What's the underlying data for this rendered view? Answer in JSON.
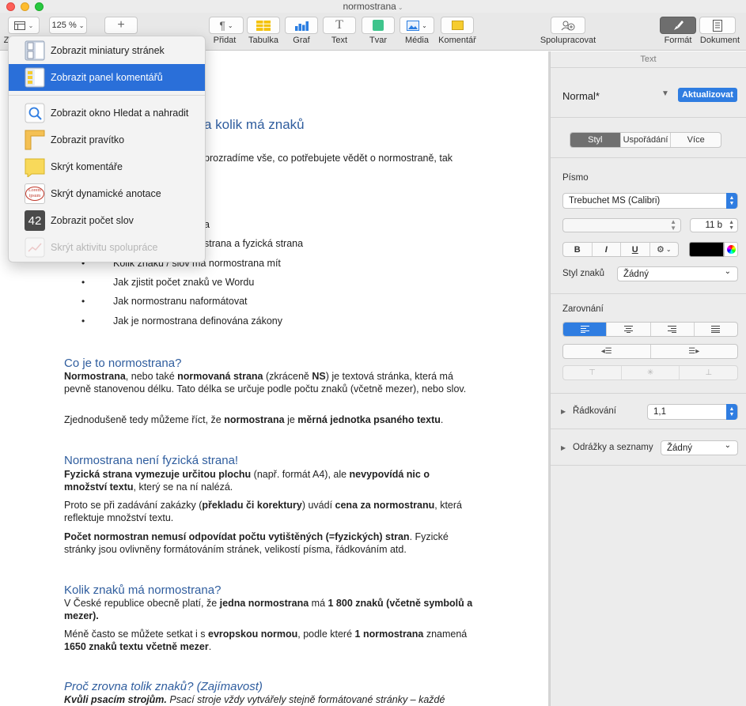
{
  "window": {
    "title": "normostrana"
  },
  "toolbar": {
    "view_label": "Z",
    "zoom_value": "125 %",
    "add_page_symbol": "+",
    "insert_label": "Přidat",
    "table_label": "Tabulka",
    "chart_label": "Graf",
    "text_label": "Text",
    "shape_label": "Tvar",
    "media_label": "Média",
    "comment_label": "Komentář",
    "collaborate_label": "Spolupracovat",
    "format_label": "Formát",
    "document_label": "Dokument"
  },
  "view_menu": {
    "items": [
      {
        "label": "Zobrazit miniatury stránek",
        "icon": "page-thumbnails-icon"
      },
      {
        "label": "Zobrazit panel komentářů",
        "icon": "comments-pane-icon"
      },
      {
        "label": "Zobrazit okno Hledat a nahradit",
        "icon": "magnifier-icon"
      },
      {
        "label": "Zobrazit pravítko",
        "icon": "ruler-icon"
      },
      {
        "label": "Skrýt komentáře",
        "icon": "sticky-note-icon"
      },
      {
        "label": "Skrýt dynamické anotace",
        "icon": "lorem-ipsum-icon",
        "icon_text": "Lorem ipsum"
      },
      {
        "label": "Zobrazit počet slov",
        "icon": "word-count-icon",
        "icon_text": "42"
      },
      {
        "label": "Skrýt aktivitu spolupráce",
        "icon": "collaboration-activity-icon"
      }
    ]
  },
  "document": {
    "title_fragment": "a kolik má znaků",
    "intro_fragment": "prozradíme vše, co potřebujete vědět o normostraně, tak",
    "toc": [
      "a",
      "strana a fyzická strana",
      "Kolik znaků / slov má normostrana mít",
      "Jak zjistit počet znaků ve Wordu",
      "Jak normostranu naformátovat",
      "Jak je normostrana definována zákony"
    ],
    "bullet_char": "•",
    "h_what": "Co je to normostrana?",
    "p_what_1": "<b>Normostrana</b>, nebo také <b>normovaná strana</b> (zkráceně <b>NS</b>) je textová stránka, která má pevně stanovenou délku. Tato délka se určuje podle počtu znaků (včetně mezer), nebo slov.",
    "p_what_2": "Zjednodušeně tedy můžeme říct, že <b>normostrana</b> je <b>měrná jednotka psaného textu</b>.",
    "h_phys": "Normostrana není fyzická strana!",
    "p_phys_1": "<b>Fyzická strana vymezuje určitou plochu</b> (např. formát A4), ale <b>nevypovídá nic o množství textu</b>, který se na ní nalézá.",
    "p_phys_2": "Proto se při zadávání zakázky (<b>překladu či korektury</b>) uvádí <b>cena za normostranu</b>, která reflektuje množství textu.",
    "p_phys_3": "<b>Počet normostran nemusí odpovídat počtu vytištěných (=fyzických) stran</b>. Fyzické stránky jsou ovlivněny formátováním stránek, velikostí písma, řádkováním atd.",
    "h_count": "Kolik znaků má normostrana?",
    "p_count_1": "V České republice obecně platí, že <b>jedna normostrana</b> má <b>1 800 znaků (včetně symbolů a mezer).</b>",
    "p_count_2": "Méně často se můžete setkat i s <b>evropskou normou</b>, podle které <b>1 normostrana</b> znamená <b>1650 znaků textu včetně mezer</b>.",
    "h_why": "Proč zrovna tolik znaků? (Zajímavost)",
    "p_why": "<b>Kvůli psacím strojům.</b> Psací stroje vždy vytvářely stejně formátované stránky – každé"
  },
  "format_panel": {
    "tab_title": "Text",
    "style_name": "Normal*",
    "update_button": "Aktualizovat",
    "tabs": [
      "Styl",
      "Uspořádání",
      "Více"
    ],
    "font_section": "Písmo",
    "font_name": "Trebuchet MS (Calibri)",
    "font_size": "11 b",
    "bold": "B",
    "italic": "I",
    "underline": "U",
    "gear": "⚙︎",
    "text_color": "#000000",
    "char_style_label": "Styl znaků",
    "char_style_value": "Žádný",
    "alignment_section": "Zarovnání",
    "line_spacing_label": "Řádkování",
    "line_spacing_value": "1,1",
    "lists_label": "Odrážky a seznamy",
    "lists_value": "Žádný",
    "chevron_down": "⌄",
    "disclosure": "▶"
  }
}
